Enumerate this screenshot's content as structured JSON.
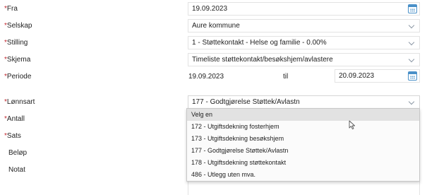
{
  "form": {
    "required_marker": "*",
    "fields": {
      "fra": {
        "label": "Fra",
        "value": "19.09.2023"
      },
      "selskap": {
        "label": "Selskap",
        "value": "Aure kommune"
      },
      "stilling": {
        "label": "Stilling",
        "value": "1 - Støttekontakt - Helse og familie - 0.00%"
      },
      "skjema": {
        "label": "Skjema",
        "value": "Timeliste støttekontakt/besøkshjem/avlastere"
      },
      "periode": {
        "label": "Periode",
        "from": "19.09.2023",
        "til_label": "til",
        "to": "20.09.2023"
      },
      "lonnsart": {
        "label": "Lønnsart",
        "value": "177 - Godtgjørelse Støttek/Avlastn"
      },
      "antall": {
        "label": "Antall"
      },
      "sats": {
        "label": "Sats"
      },
      "belop": {
        "label": "Beløp"
      },
      "notat": {
        "label": "Notat"
      }
    }
  },
  "lonnsart_dropdown": {
    "options": [
      "Velg en",
      "172 - Utgiftsdekning fosterhjem",
      "173 - Utgiftsdekning besøkshjem",
      "177 - Godtgjørelse Støttek/Avlastn",
      "178 - Utgiftsdekning støttekontakt",
      "486 - Utlegg uten mva."
    ]
  },
  "icons": {
    "calendar": "calendar-icon",
    "chevron": "chevron-down-icon",
    "cursor": "mouse-cursor-icon"
  },
  "colors": {
    "required": "#c0282f",
    "calendar_accent": "#4a90c8",
    "highlight_option": "#e2e2e2"
  }
}
